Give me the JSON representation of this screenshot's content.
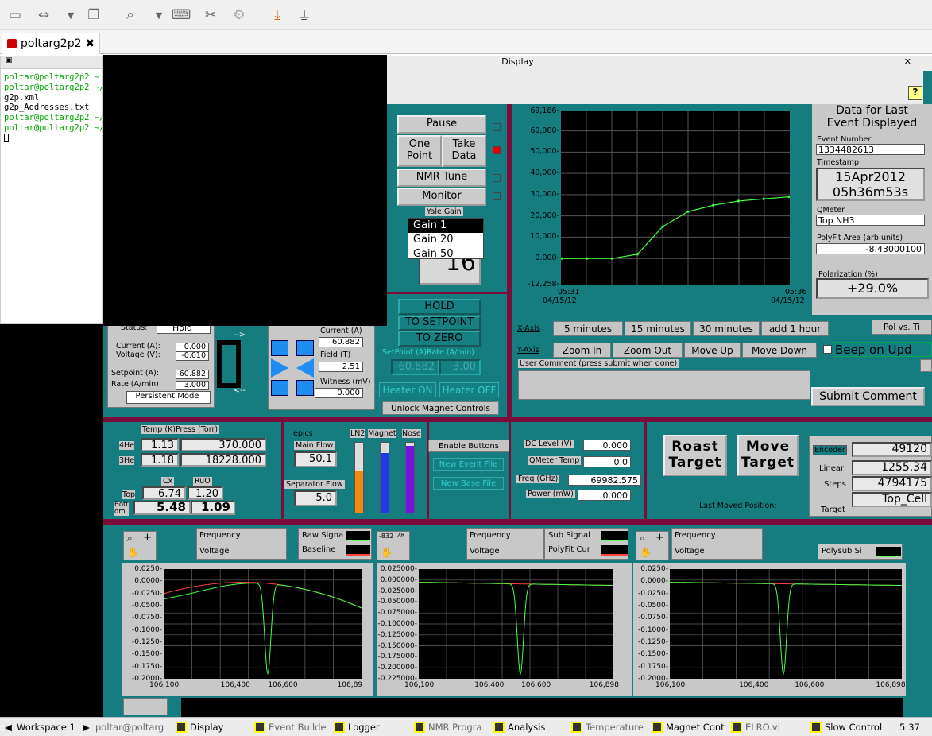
{
  "toolbar": {
    "icons": [
      "window-icon",
      "move-icon",
      "chevron-down-icon",
      "restore-icon",
      "zoom-icon",
      "chevron-down-icon",
      "keyboard-icon",
      "tools-icon",
      "gears-icon",
      "download-icon",
      "plug-icon"
    ]
  },
  "tab": {
    "label": "poltarg2p2"
  },
  "terminal": {
    "lines": [
      {
        "t": "poltar@poltarg2p2 ~ $",
        "c": "g"
      },
      {
        "t": "poltar@poltarg2p2 ~/P",
        "c": "g"
      },
      {
        "t": "g2p.xml",
        "c": ""
      },
      {
        "t": "g2p_Addresses.txt",
        "c": ""
      },
      {
        "t": "poltar@poltarg2p2 ~/P",
        "c": "g"
      },
      {
        "t": "poltar@poltarg2p2 ~/P",
        "c": "g"
      }
    ]
  },
  "display": {
    "title": "Display",
    "help": "?"
  },
  "controls": {
    "pause": "Pause",
    "one_point": "One\nPoint",
    "take_data": "Take\nData",
    "nmr_tune": "NMR Tune",
    "monitor": "Monitor",
    "yale_gain": "Yale Gain",
    "gains": [
      "Gain 1",
      "Gain 20",
      "Gain 50"
    ],
    "gain_value": "16"
  },
  "magnet": {
    "hold": "HOLD",
    "to_setpoint": "TO SETPOINT",
    "to_zero": "TO ZERO",
    "setpoint_rate_label": "SetPoint (A)Rate (A/min)",
    "setpoint": "60.882",
    "rate": "3.00",
    "heater_on": "Heater ON",
    "heater_off": "Heater OFF",
    "unlock": "Unlock Magnet Controls",
    "status_label": "Status:",
    "status": "Hold",
    "current_label": "Current (A):",
    "current": "0.000",
    "voltage_label": "Voltage (V):",
    "voltage": "-0.010",
    "setpoint_label": "Setpoint (A):",
    "setpoint2": "60.882",
    "rate_label": "Rate (A/min):",
    "rate2": "3.000",
    "persistent": "Persistent Mode",
    "arrow_right": "-->",
    "arrow_left": "<--",
    "cur_a_label": "Current (A)",
    "cur_a": "60.882",
    "field_label": "Field (T)",
    "field": "2.51",
    "witness_label": "Witness (mV)",
    "witness": "0.000"
  },
  "chart_main": {
    "ymax": "69,186-",
    "yticks": [
      "60,000-",
      "50,000-",
      "40,000-",
      "30,000-",
      "20,000-",
      "10,000-",
      "0.000-",
      "-12,258-"
    ],
    "x_left_time": "05:31",
    "x_left_date": "04/15/12",
    "x_right_time": "05:36",
    "x_right_date": "04/15/12"
  },
  "chart_data": {
    "type": "line",
    "x": [
      "05:31",
      "05:32",
      "05:33",
      "05:33",
      "05:34",
      "05:34",
      "05:35",
      "05:35",
      "05:36",
      "05:36"
    ],
    "series": [
      {
        "values": [
          0,
          0,
          0,
          2000,
          15000,
          22000,
          25000,
          27000,
          28000,
          29000
        ]
      }
    ],
    "ylim": [
      -12258,
      69186
    ]
  },
  "xaxis": {
    "label": "X-Axis",
    "opts": [
      "5 minutes",
      "15 minutes",
      "30 minutes",
      "add 1 hour"
    ]
  },
  "yaxis": {
    "label": "Y-Axis",
    "opts": [
      "Zoom In",
      "Zoom Out",
      "Move Up",
      "Move Down"
    ]
  },
  "beep": "Beep on Upd",
  "pol_vs": "Pol vs. Ti",
  "comment": {
    "label": "User Comment (press submit when done)",
    "submit": "Submit Comment"
  },
  "event": {
    "title1": "Data for Last",
    "title2": "Event Displayed",
    "number_label": "Event Number",
    "number": "1334482613",
    "timestamp_label": "Timestamp",
    "date": "15Apr2012",
    "time": "05h36m53s",
    "qmeter_label": "QMeter",
    "qmeter": "Top NH3",
    "polyfit_label": "PolyFit Area (arb units)",
    "polyfit": "-8.43000100",
    "pol_label": "Polarization (%)",
    "pol": "+29.0%"
  },
  "temps": {
    "header": "Temp (K)Press (Torr)",
    "he4": "4He",
    "he4_t": "1.13",
    "he4_p": "370.000",
    "he3": "3He",
    "he3_t": "1.18",
    "he3_p": "18228.000",
    "cx": "Cx",
    "ruo": "RuO",
    "top": "Top",
    "top_cx": "6.74",
    "top_ruo": "1.20",
    "bottom": "Bott\nom",
    "bot_cx": "5.48",
    "bot_ruo": "1.09"
  },
  "flows": {
    "epics": "epics",
    "main_flow_label": "Main Flow",
    "main_flow": "50.1",
    "sep_flow_label": "Separator Flow",
    "sep_flow": "5.0",
    "ln2": "LN2",
    "magnet": "Magnet",
    "nose": "Nose",
    "ln2_level": 0.6,
    "magnet_level": 0.85,
    "nose_level": 0.95
  },
  "files": {
    "enable": "Enable Buttons",
    "new_event": "New Event File",
    "new_base": "New Base File"
  },
  "dc": {
    "dc_label": "DC Level (V)",
    "dc": "0.000",
    "qtemp_label": "QMeter Temp",
    "qtemp": "0.0",
    "freq_label": "Freq (GHz)",
    "freq": "69982.575",
    "power_label": "Power (mW)",
    "power": "0.000"
  },
  "target": {
    "roast": "Roast\nTarget",
    "move": "Move\nTarget",
    "last_moved": "Last Moved Position:",
    "encoder_label": "Encoder",
    "encoder": "49120",
    "linear_label": "Linear",
    "linear": "1255.34",
    "steps_label": "Steps",
    "steps": "4794175",
    "target_label": "Target",
    "target": "Top_Cell"
  },
  "nmr": {
    "freq": "Frequency",
    "volt": "Voltage",
    "raw": "Raw Signa",
    "baseline": "Baseline",
    "sub": "Sub Signal",
    "polyfit": "PolyFit Cur",
    "polysub": "Polysub Si",
    "small1": "-832",
    "small2": "28."
  },
  "nmr1": {
    "yticks": [
      "0.0250-",
      "0.0000-",
      "-0.0250-",
      "-0.0500-",
      "-0.0750-",
      "-0.1000-",
      "-0.1250-",
      "-0.1500-",
      "-0.1750-",
      "-0.2000-"
    ],
    "xticks": [
      "106,100",
      "106,400",
      "106,600",
      "106,89"
    ]
  },
  "nmr2": {
    "yticks": [
      "0.025000-",
      "0.000000-",
      "-0.025000-",
      "-0.050000-",
      "-0.075000-",
      "-0.100000-",
      "-0.125000-",
      "-0.150000-",
      "-0.175000-",
      "-0.200000-",
      "-0.225000-"
    ],
    "xticks": [
      "106,100",
      "106,400",
      "106,600",
      "106,898"
    ]
  },
  "nmr3": {
    "yticks": [
      "0.0250-",
      "0.0000-",
      "-0.0250-",
      "-0.0500-",
      "-0.0750-",
      "-0.1000-",
      "-0.1250-",
      "-0.1500-",
      "-0.1750-",
      "-0.2000-"
    ],
    "xticks": [
      "106,100",
      "106,400",
      "106,600",
      "106,898"
    ]
  },
  "taskbar": {
    "workspace": "Workspace 1",
    "items": [
      "poltar@poltarg",
      "Display",
      "Event Builde",
      "Logger",
      "NMR Progra",
      "Analysis",
      "Temperature",
      "Magnet Cont",
      "ELRO.vi",
      "Slow Control"
    ],
    "clock": "5:37"
  }
}
